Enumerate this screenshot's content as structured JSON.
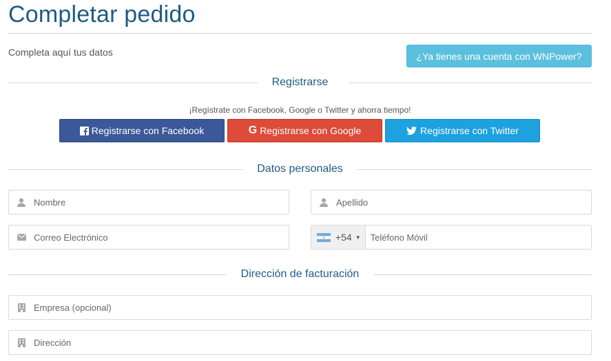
{
  "page": {
    "title": "Completar pedido",
    "subtitle": "Completa aquí tus datos",
    "login_button": "¿Ya tienes una cuenta con WNPower?"
  },
  "register": {
    "heading": "Registrarse",
    "hint": "¡Regístrate con Facebook, Google o Twitter y ahorra tiempo!",
    "facebook": "Registrarse con Facebook",
    "google": "Registrarse con Google",
    "twitter": "Registrarse con Twitter"
  },
  "personal": {
    "heading": "Datos personales",
    "nombre_placeholder": "Nombre",
    "apellido_placeholder": "Apellido",
    "email_placeholder": "Correo Electrónico",
    "phone_code": "+54",
    "phone_placeholder": "Teléfono Móvil"
  },
  "billing": {
    "heading": "Dirección de facturación",
    "empresa_placeholder": "Empresa (opcional)",
    "direccion_placeholder": "Dirección"
  },
  "icons": {
    "user": "user-icon",
    "envelope": "envelope-icon",
    "building": "building-icon",
    "flag": "argentina-flag-icon",
    "facebook": "facebook-icon",
    "google": "google-icon",
    "twitter": "twitter-icon"
  },
  "colors": {
    "title": "#1f5b84",
    "login_button": "#5bc0de",
    "facebook": "#3b5998",
    "google": "#dd4b39",
    "twitter": "#1da1df"
  }
}
